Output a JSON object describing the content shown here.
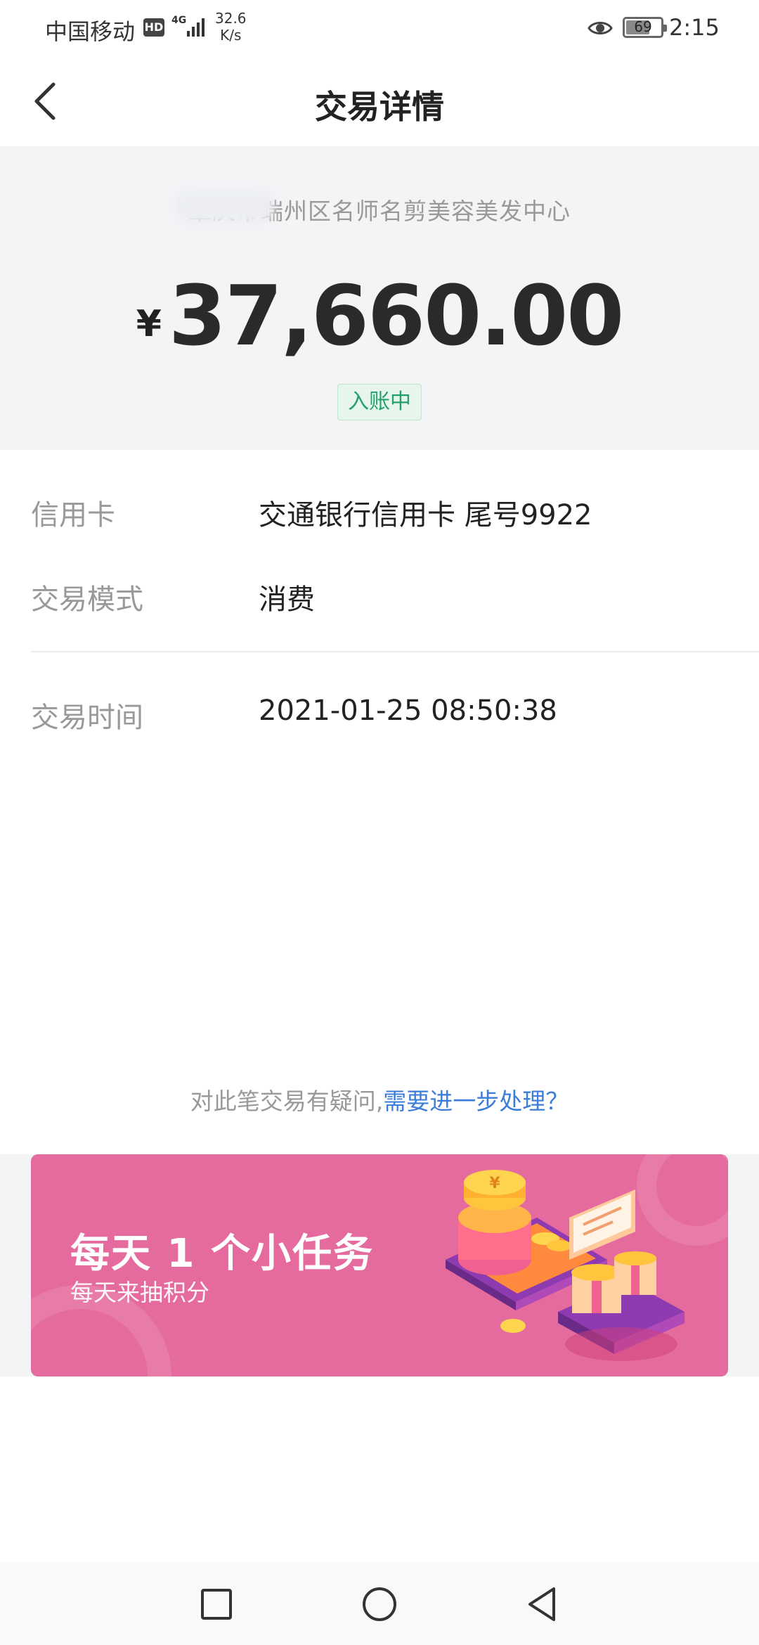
{
  "status_bar": {
    "carrier": "中国移动",
    "hd": "HD",
    "network": "4G",
    "speed_value": "32.6",
    "speed_unit": "K/s",
    "battery": "69",
    "time": "2:15"
  },
  "header": {
    "title": "交易详情"
  },
  "summary": {
    "merchant": "肇庆市端州区名师名剪美容美发中心",
    "currency_symbol": "¥",
    "amount": "37,660.00",
    "status": "入账中",
    "status_color": "#25a06a"
  },
  "details": [
    {
      "label": "信用卡",
      "value": "交通银行信用卡 尾号9922"
    },
    {
      "label": "交易模式",
      "value": "消费"
    },
    {
      "label": "交易时间",
      "value": "2021-01-25 08:50:38"
    }
  ],
  "help": {
    "text": "对此笔交易有疑问,",
    "link": "需要进一步处理？",
    "link_color": "#3b7dd8"
  },
  "banner": {
    "title": "每天 1 个小任务",
    "subtitle": "每天来抽积分",
    "background_color": "#e56a9e"
  },
  "icons": {
    "back": "chevron-left-icon",
    "recents": "square-icon",
    "home": "circle-icon",
    "system_back": "triangle-back-icon"
  }
}
